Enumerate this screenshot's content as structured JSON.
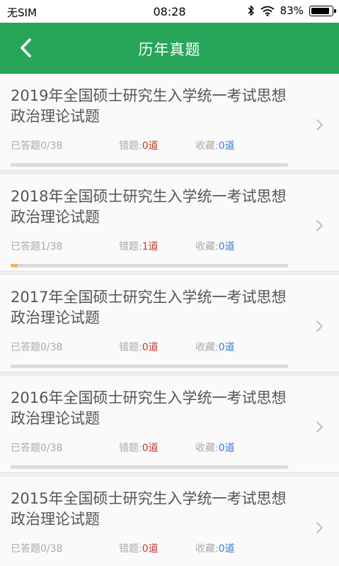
{
  "status_bar": {
    "carrier": "无SIM",
    "time": "08:28",
    "battery": "83%",
    "battery_level": 0.83
  },
  "header": {
    "title": "历年真题",
    "back_icon": "chevron-left-icon"
  },
  "colors": {
    "header_bg": "#27a65a",
    "wrong_value": "#c0392b",
    "favorite_value": "#3a7bd5",
    "progress": "#f6b26b"
  },
  "items": [
    {
      "title": "2019年全国硕士研究生入学统一考试思想政治理论试题",
      "answered_label": "已答题",
      "answered": "0/38",
      "progress": 0,
      "wrong_label": "错题:",
      "wrong": "0道",
      "favorite_label": "收藏:",
      "favorite": "0道"
    },
    {
      "title": "2018年全国硕士研究生入学统一考试思想政治理论试题",
      "answered_label": "已答题",
      "answered": "1/38",
      "progress": 0.026,
      "wrong_label": "错题:",
      "wrong": "1道",
      "favorite_label": "收藏:",
      "favorite": "0道"
    },
    {
      "title": "2017年全国硕士研究生入学统一考试思想政治理论试题",
      "answered_label": "已答题",
      "answered": "0/38",
      "progress": 0,
      "wrong_label": "错题:",
      "wrong": "0道",
      "favorite_label": "收藏:",
      "favorite": "0道"
    },
    {
      "title": "2016年全国硕士研究生入学统一考试思想政治理论试题",
      "answered_label": "已答题",
      "answered": "0/38",
      "progress": 0,
      "wrong_label": "错题:",
      "wrong": "0道",
      "favorite_label": "收藏:",
      "favorite": "0道"
    },
    {
      "title": "2015年全国硕士研究生入学统一考试思想政治理论试题",
      "answered_label": "已答题",
      "answered": "0/38",
      "progress": 0,
      "wrong_label": "错题:",
      "wrong": "0道",
      "favorite_label": "收藏:",
      "favorite": "0道"
    }
  ]
}
